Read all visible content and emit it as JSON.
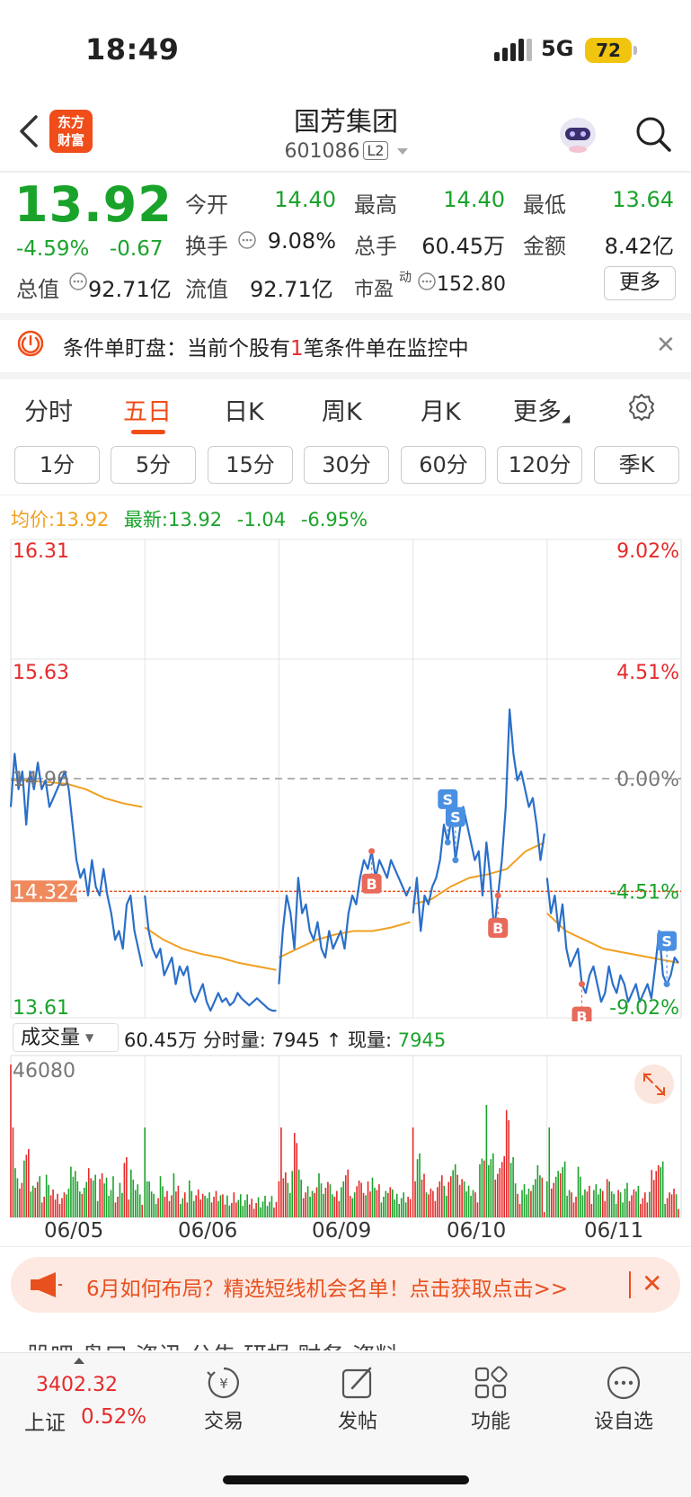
{
  "status_bar": {
    "time": "18:49",
    "network": "5G",
    "battery": "72"
  },
  "header": {
    "logo_line1": "东方",
    "logo_line2": "财富",
    "title": "国芳集团",
    "code": "601086",
    "level": "L2"
  },
  "quote": {
    "price": "13.92",
    "change_pct": "-4.59%",
    "change": "-0.67",
    "open_label": "今开",
    "open": "14.40",
    "high_label": "最高",
    "high": "14.40",
    "low_label": "最低",
    "low": "13.64",
    "turnover_label": "换手",
    "turnover": "9.08%",
    "volume_label": "总手",
    "volume": "60.45万",
    "amount_label": "金额",
    "amount": "8.42亿",
    "mktcap_label": "总值",
    "mktcap": "92.71亿",
    "float_label": "流值",
    "float": "92.71亿",
    "pe_label": "市盈",
    "pe_sup": "动",
    "pe": "152.80",
    "more_button": "更多"
  },
  "notice": {
    "prefix": "条件单盯盘：当前个股有",
    "count": "1",
    "suffix": "笔条件单在监控中"
  },
  "tabs": [
    "分时",
    "五日",
    "日K",
    "周K",
    "月K",
    "更多"
  ],
  "active_tab": "五日",
  "periods": [
    "1分",
    "5分",
    "15分",
    "30分",
    "60分",
    "120分",
    "季K"
  ],
  "legend": {
    "avg_label": "均价:",
    "avg": "13.92",
    "last_label": "最新:",
    "last": "13.92",
    "chg": "-1.04",
    "pct": "-6.95%"
  },
  "chart_data": {
    "type": "line",
    "y_left_ticks": [
      "16.31",
      "15.63",
      "14.96",
      "14.324",
      "13.61"
    ],
    "y_right_ticks": [
      "9.02%",
      "4.51%",
      "0.00%",
      "-4.51%",
      "-9.02%"
    ],
    "ylim": [
      13.61,
      16.31
    ],
    "prev_close": 14.96,
    "marker_line": 14.324,
    "x_dates": [
      "06/05",
      "06/06",
      "06/09",
      "06/10",
      "06/11"
    ],
    "series": [
      {
        "values_per_day": [
          [
            14.8,
            15.1,
            14.9,
            15.0,
            14.7,
            15.0,
            14.9,
            15.05,
            14.9,
            14.95,
            14.8,
            14.85,
            14.9,
            14.95,
            15.0,
            14.9,
            14.7,
            14.5,
            14.4,
            14.45,
            14.3,
            14.5,
            14.35,
            14.3,
            14.45,
            14.3,
            14.2,
            14.05,
            14.1,
            14.0,
            14.25,
            14.3,
            14.1,
            14.0,
            13.9
          ],
          [
            14.3,
            14.1,
            14.0,
            13.95,
            14.0,
            13.85,
            13.9,
            13.95,
            13.8,
            13.9,
            13.85,
            13.9,
            13.75,
            13.7,
            13.75,
            13.8,
            13.7,
            13.65,
            13.7,
            13.75,
            13.7,
            13.72,
            13.68,
            13.7,
            13.75,
            13.72,
            13.7,
            13.68,
            13.7,
            13.72,
            13.7,
            13.68,
            13.66,
            13.65,
            13.65
          ],
          [
            13.8,
            14.1,
            14.3,
            14.2,
            14.0,
            14.4,
            14.2,
            14.25,
            14.1,
            14.05,
            14.15,
            14.0,
            13.95,
            14.1,
            14.0,
            14.05,
            14.1,
            14.0,
            14.2,
            14.3,
            14.25,
            14.4,
            14.5,
            14.45,
            14.55,
            14.4,
            14.5,
            14.45,
            14.4,
            14.5,
            14.45,
            14.4,
            14.35,
            14.3,
            14.35
          ],
          [
            14.2,
            14.4,
            14.1,
            14.3,
            14.25,
            14.35,
            14.4,
            14.5,
            14.7,
            14.6,
            14.75,
            14.5,
            14.65,
            14.8,
            14.7,
            14.6,
            14.5,
            14.55,
            14.3,
            14.6,
            14.4,
            14.1,
            14.3,
            14.5,
            14.8,
            15.35,
            15.1,
            14.95,
            15.0,
            14.9,
            14.8,
            14.85,
            14.7,
            14.5,
            14.65
          ],
          [
            14.4,
            14.2,
            14.3,
            14.1,
            14.25,
            14.0,
            13.9,
            13.95,
            14.0,
            13.8,
            13.75,
            13.85,
            13.9,
            13.8,
            13.7,
            13.75,
            13.9,
            13.8,
            13.75,
            13.85,
            13.8,
            13.7,
            13.75,
            13.8,
            13.7,
            13.75,
            13.8,
            13.72,
            13.9,
            14.1,
            13.85,
            13.8,
            13.85,
            13.95,
            13.92
          ]
        ]
      }
    ],
    "avg_per_day": [
      [
        14.95,
        14.95,
        14.94,
        14.93,
        14.9,
        14.85,
        14.82,
        14.8
      ],
      [
        14.12,
        14.05,
        14.0,
        13.97,
        13.95,
        13.92,
        13.9,
        13.88
      ],
      [
        13.95,
        14.0,
        14.05,
        14.08,
        14.1,
        14.1,
        14.12,
        14.15
      ],
      [
        14.25,
        14.28,
        14.35,
        14.4,
        14.42,
        14.45,
        14.55,
        14.6
      ],
      [
        14.2,
        14.1,
        14.05,
        14.0,
        13.98,
        13.96,
        13.94,
        13.92
      ]
    ],
    "markers": [
      {
        "label": "B",
        "day": 2,
        "pos": 0.7
      },
      {
        "label": "S",
        "day": 3,
        "pos": 0.25
      },
      {
        "label": "S",
        "day": 3,
        "pos": 0.33
      },
      {
        "label": "B",
        "day": 3,
        "pos": 0.65
      },
      {
        "label": "B",
        "day": 4,
        "pos": 0.25
      },
      {
        "label": "S",
        "day": 4,
        "pos": 0.9
      }
    ]
  },
  "volume": {
    "label": "成交量",
    "total": "60.45万",
    "tick_label": "分时量:",
    "tick_value": "7945",
    "now_label": "现量:",
    "now_value": "7945",
    "max_tick": "46080"
  },
  "banner": {
    "text": "6月如何布局？精选短线机会名单！点击获取点击>>"
  },
  "sub_tabs": "股吧      盘口      资讯      公告      研报      财务      资料",
  "bottom_nav": {
    "index_value": "3402.32",
    "index_name": "上证",
    "index_pct": "0.52%",
    "items": [
      "交易",
      "发帖",
      "功能",
      "设自选"
    ]
  },
  "colors": {
    "up": "#e52a2a",
    "down": "#1aa32b",
    "avg": "#f0a020",
    "line": "#2a6fc9",
    "accent": "#f04d1a"
  }
}
